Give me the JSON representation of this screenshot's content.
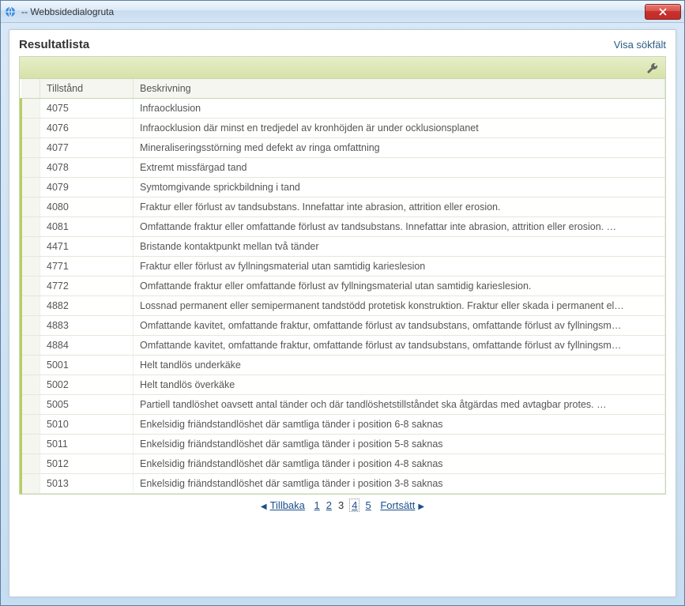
{
  "window": {
    "title": "-- Webbsidedialogruta"
  },
  "header": {
    "title": "Resultatlista",
    "show_search": "Visa sökfält"
  },
  "columns": {
    "code": "Tillstånd",
    "desc": "Beskrivning"
  },
  "rows": [
    {
      "code": "4075",
      "desc": "Infraocklusion"
    },
    {
      "code": "4076",
      "desc": "Infraocklusion där minst en tredjedel av kronhöjden är under ocklusionsplanet"
    },
    {
      "code": "4077",
      "desc": "Mineraliseringsstörning med defekt av ringa omfattning"
    },
    {
      "code": "4078",
      "desc": "Extremt missfärgad tand"
    },
    {
      "code": "4079",
      "desc": "Symtomgivande sprickbildning i tand"
    },
    {
      "code": "4080",
      "desc": "Fraktur eller förlust av tandsubstans. Innefattar inte abrasion, attrition eller erosion."
    },
    {
      "code": "4081",
      "desc": "Omfattande fraktur eller omfattande förlust av tandsubstans. Innefattar inte abrasion, attrition eller erosion.   …"
    },
    {
      "code": "4471",
      "desc": "Bristande kontaktpunkt mellan två tänder"
    },
    {
      "code": "4771",
      "desc": "Fraktur eller förlust av fyllningsmaterial utan samtidig karieslesion"
    },
    {
      "code": "4772",
      "desc": "Omfattande fraktur eller omfattande förlust av fyllningsmaterial utan samtidig karieslesion."
    },
    {
      "code": "4882",
      "desc": "Lossnad permanent eller semipermanent tandstödd protetisk konstruktion. Fraktur eller skada i permanent el…"
    },
    {
      "code": "4883",
      "desc": "Omfattande kavitet, omfattande fraktur, omfattande förlust av tandsubstans, omfattande förlust av fyllningsm…"
    },
    {
      "code": "4884",
      "desc": "Omfattande kavitet, omfattande fraktur, omfattande förlust av tandsubstans, omfattande förlust av fyllningsm…"
    },
    {
      "code": "5001",
      "desc": "Helt tandlös underkäke"
    },
    {
      "code": "5002",
      "desc": "Helt tandlös överkäke"
    },
    {
      "code": "5005",
      "desc": "Partiell tandlöshet oavsett antal tänder och där tandlöshetstillståndet ska åtgärdas med avtagbar protes.      …"
    },
    {
      "code": "5010",
      "desc": "Enkelsidig friändstandlöshet där samtliga tänder i position 6-8 saknas"
    },
    {
      "code": "5011",
      "desc": "Enkelsidig friändstandlöshet där samtliga tänder i position 5-8 saknas"
    },
    {
      "code": "5012",
      "desc": "Enkelsidig friändstandlöshet där samtliga tänder i position 4-8 saknas"
    },
    {
      "code": "5013",
      "desc": "Enkelsidig friändstandlöshet där samtliga tänder i position 3-8 saknas"
    }
  ],
  "pager": {
    "prev": "Tillbaka",
    "next": "Fortsätt",
    "pages": [
      "1",
      "2",
      "3",
      "4",
      "5"
    ],
    "current": "3",
    "focused": "4"
  }
}
